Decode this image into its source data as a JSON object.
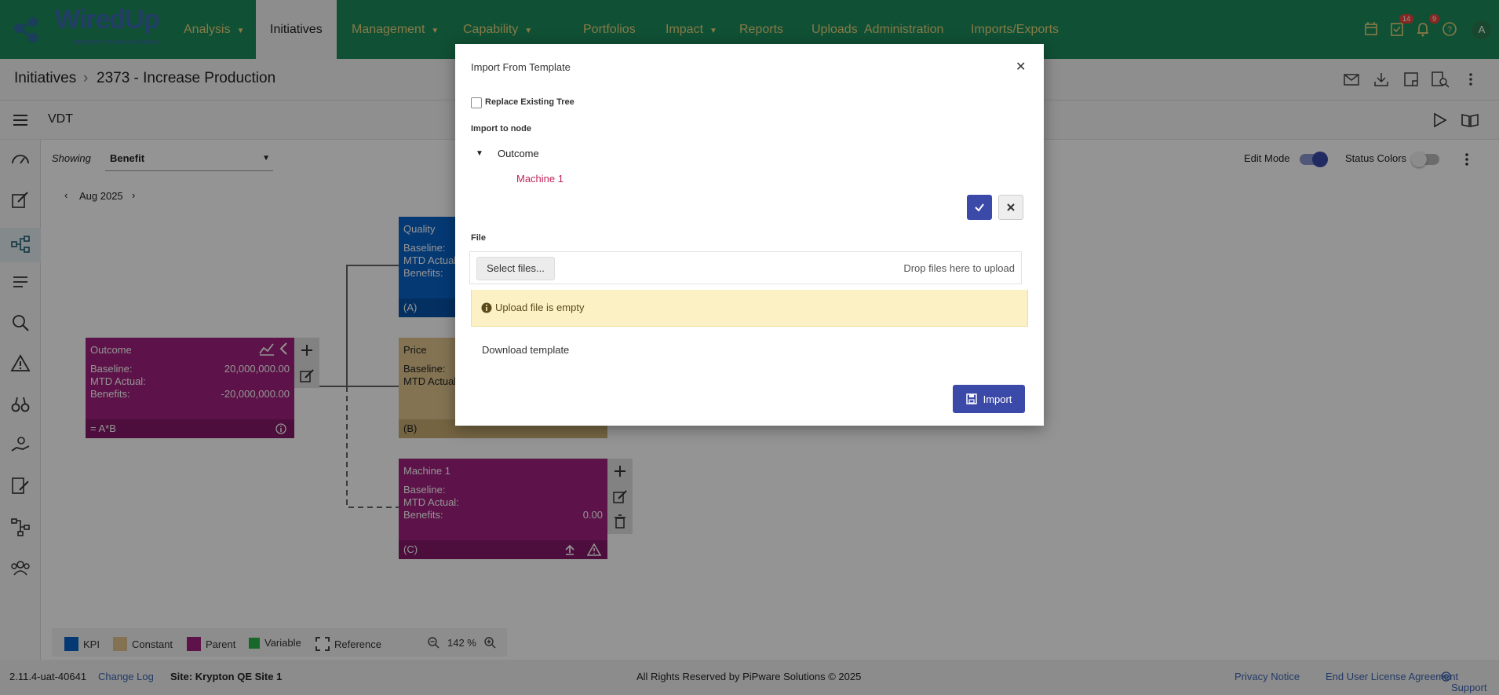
{
  "app": {
    "logo_text": "WiredUp",
    "logo_sub": "for performance excellence"
  },
  "nav": {
    "analysis": "Analysis",
    "initiatives": "Initiatives",
    "management": "Management",
    "capability": "Capability",
    "portfolios": "Portfolios",
    "impact": "Impact",
    "reports": "Reports",
    "uploads": "Uploads",
    "administration": "Administration",
    "imports_exports": "Imports/Exports",
    "badge_tasks": "14",
    "badge_notifications": "9",
    "avatar": "A"
  },
  "breadcrumb": {
    "root": "Initiatives",
    "sep": "›",
    "current": "2373 - Increase Production"
  },
  "toolbar": {
    "title": "VDT"
  },
  "controls": {
    "showing_label": "Showing",
    "showing_value": "Benefit",
    "period": "Aug 2025",
    "edit_mode": "Edit Mode",
    "status_colors": "Status Colors"
  },
  "nodes": {
    "quality": {
      "title": "Quality",
      "baseline": "Baseline:",
      "mtd": "MTD Actual:",
      "benefits": "Benefits:",
      "foot": "(A)"
    },
    "outcome": {
      "title": "Outcome",
      "baseline": "Baseline:",
      "baseline_val": "20,000,000.00",
      "mtd": "MTD Actual:",
      "benefits": "Benefits:",
      "benefits_val": "-20,000,000.00",
      "foot": "= A*B"
    },
    "price": {
      "title": "Price",
      "baseline": "Baseline:",
      "mtd": "MTD Actual:",
      "foot": "(B)"
    },
    "machine": {
      "title": "Machine 1",
      "baseline": "Baseline:",
      "mtd": "MTD Actual:",
      "benefits": "Benefits:",
      "benefits_val": "0.00",
      "foot": "(C)"
    }
  },
  "legend": {
    "kpi": "KPI",
    "constant": "Constant",
    "parent": "Parent",
    "variable": "Variable",
    "reference": "Reference",
    "zoom": "142 %",
    "colors": {
      "kpi": "#0a63c9",
      "constant": "#e2c68f",
      "parent": "#a0227f",
      "variable": "#2bb34a"
    }
  },
  "footer": {
    "version": "2.11.4-uat-40641",
    "changelog": "Change Log",
    "site": "Site: Krypton QE Site 1",
    "copyright": "All Rights Reserved by PiPware Solutions © 2025",
    "privacy": "Privacy Notice",
    "eula": "End User License Agreement",
    "support": "Support"
  },
  "modal": {
    "title": "Import From Template",
    "replace_label": "Replace Existing Tree",
    "import_to_node": "Import to node",
    "tree_root": "Outcome",
    "tree_child": "Machine 1",
    "file_label": "File",
    "select_files": "Select files...",
    "drop_text": "Drop files here to upload",
    "warning": "Upload file is empty",
    "download_template": "Download template",
    "import_button": "Import"
  }
}
